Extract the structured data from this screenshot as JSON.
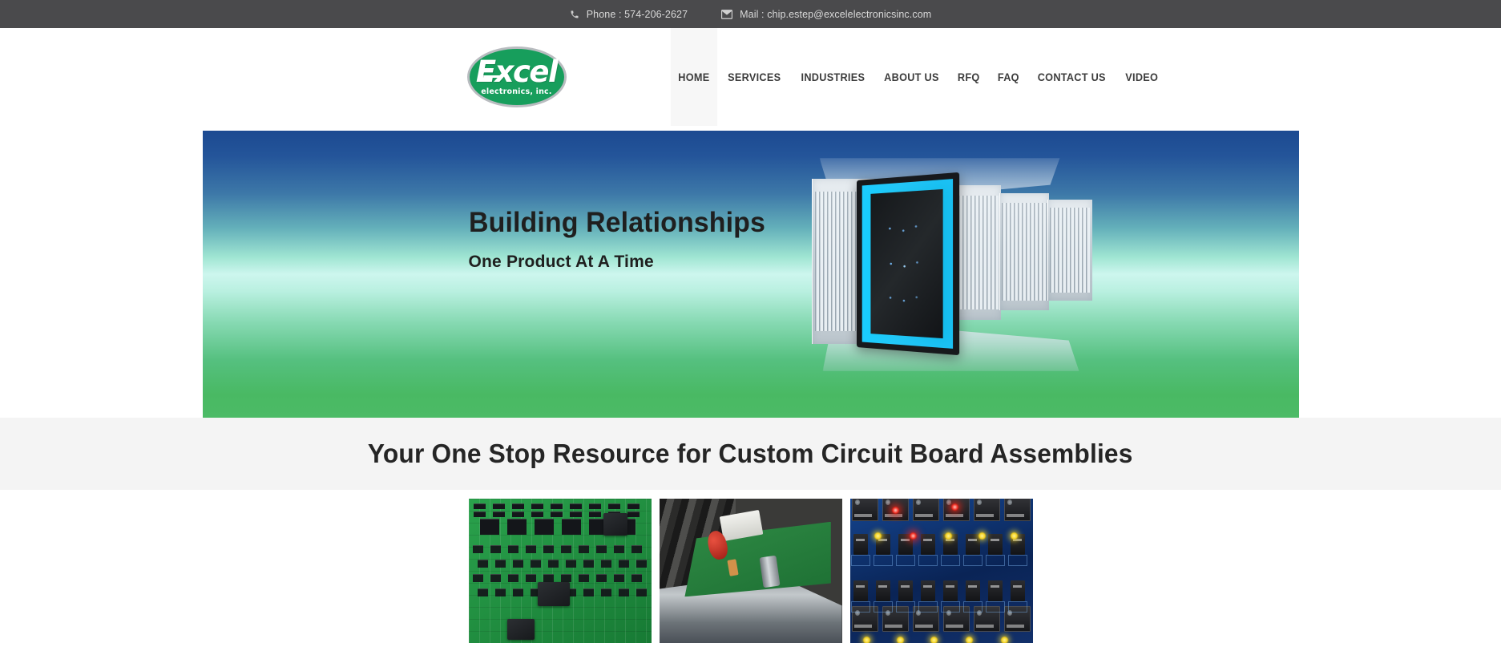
{
  "topbar": {
    "phone_icon": "phone-icon",
    "phone_label": "Phone : 574-206-2627",
    "mail_icon": "mail-icon",
    "mail_label": "Mail : chip.estep@excelelectronicsinc.com"
  },
  "header": {
    "logo": {
      "word": "Excel",
      "sub": "electronics, inc.",
      "oval_color": "#179e5c",
      "ring_color": "#b9bcc0"
    },
    "nav": [
      {
        "label": "HOME",
        "active": true
      },
      {
        "label": "SERVICES",
        "active": false
      },
      {
        "label": "INDUSTRIES",
        "active": false
      },
      {
        "label": "ABOUT US",
        "active": false
      },
      {
        "label": "RFQ",
        "active": false
      },
      {
        "label": "FAQ",
        "active": false
      },
      {
        "label": "CONTACT US",
        "active": false
      },
      {
        "label": "VIDEO",
        "active": false
      }
    ]
  },
  "hero": {
    "headline": "Building Relationships",
    "subheadline": "One Product At A Time",
    "artwork_name": "server-rack-datacenter-image",
    "gradient_top": "#1c4a91",
    "gradient_mid": "#cdf6ee",
    "gradient_bottom": "#4cbb66"
  },
  "band": {
    "title": "Your One Stop Resource for Custom Circuit Board Assemblies",
    "background": "#f4f4f4"
  },
  "gallery": {
    "tiles": [
      {
        "name": "green-smt-circuit-board-photo"
      },
      {
        "name": "circuit-board-on-assembly-machine-photo"
      },
      {
        "name": "blue-relay-board-photo"
      }
    ]
  }
}
